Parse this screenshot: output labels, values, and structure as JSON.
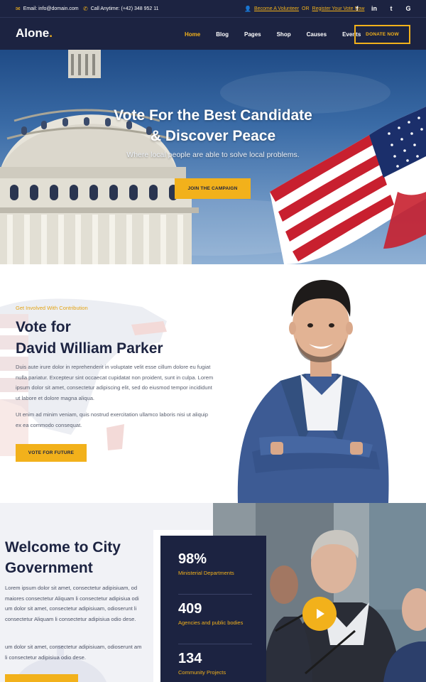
{
  "topbar": {
    "email": "Email: info@domain.com",
    "phone": "Call Anytime: (+42) 348 952 11",
    "volunteer": "Become A Volunteer",
    "or": "OR",
    "register": "Register Your Vote Now",
    "social": [
      "f",
      "in",
      "t",
      "G"
    ]
  },
  "nav": {
    "logo": "Alone",
    "logo_dot": ".",
    "items": [
      "Home",
      "Blog",
      "Pages",
      "Shop",
      "Causes",
      "Events"
    ],
    "active": "Home",
    "donate": "DONATE NOW"
  },
  "hero": {
    "title_line1": "Vote For the Best Candidate",
    "title_line2": "& Discover Peace",
    "subtitle": "Where local people are able to solve local problems.",
    "button": "JOIN THE CAMPAIGN"
  },
  "candidate": {
    "kicker": "Get Involved With Contribution",
    "title_line1": "Vote for",
    "title_line2": "David William Parker",
    "para1": "Duis aute irure dolor in reprehenderit in voluptate velit esse cillum dolore eu fugiat nulla pariatur. Excepteur sint occaecat cupidatat non proident, sunt in culpa. Lorem ipsum dolor sit amet, consectetur adipiscing elit, sed do eiusmod tempor incididunt ut labore et dolore magna aliqua.",
    "para2": "Ut enim ad minim veniam, quis nostrud exercitation ullamco laboris nisi ut aliquip ex ea commodo consequat.",
    "button": "VOTE FOR FUTURE"
  },
  "city": {
    "title_line1": "Welcome to City",
    "title_line2": "Government",
    "para1": "Lorem ipsum dolor sit amet, consectetur adipisiuam, od maiores consectetur Aliquam li consectetur adipisiua odi um dolor sit amet, consectetur adipisiuam, odioserunt li consectetur Aliquam li consectetur adipisiua odio dese.",
    "para2": "um dolor sit amet, consectetur adipisiuam, odioserunt am li consectetur adipisiua odio dese.",
    "button": "",
    "stats": [
      {
        "value": "98%",
        "label": "Ministerial Departments"
      },
      {
        "value": "409",
        "label": "Agencies and public bodies"
      },
      {
        "value": "134",
        "label": "Community Projects"
      }
    ]
  },
  "colors": {
    "navy": "#1c2341",
    "accent": "#f2b11b"
  },
  "icons": [
    "mail-icon",
    "phone-icon",
    "user-icon",
    "facebook-icon",
    "linkedin-icon",
    "twitter-icon",
    "google-icon",
    "play-icon"
  ]
}
